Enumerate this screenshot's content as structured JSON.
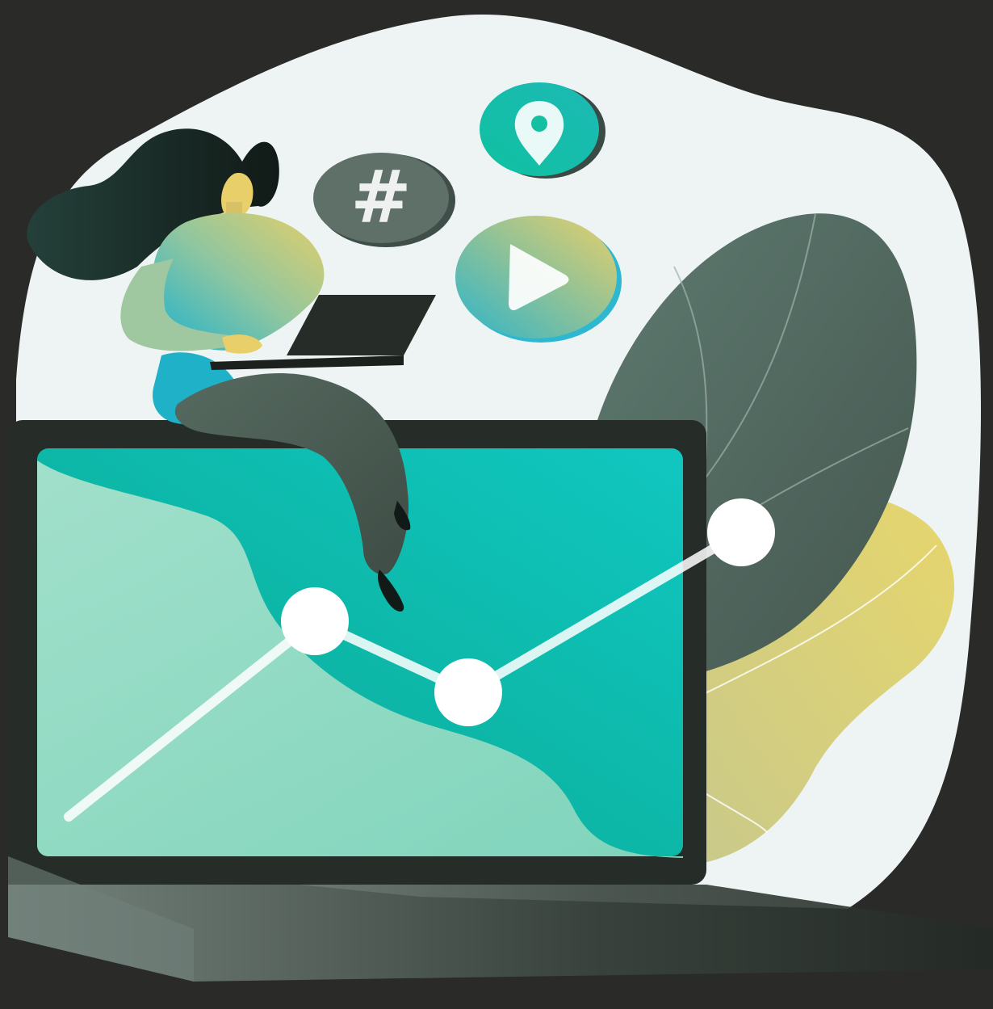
{
  "palette": {
    "background": "#2a2a29",
    "blob": "#eef4f3",
    "monitor_frame": "#262c27",
    "screen_teal": "#0bbfa6",
    "screen_mint": "#9adcc6",
    "leaf_dark": "#5a7068",
    "leaf_yellow": "#e4d270",
    "hair": "#1b2a26",
    "skin_yellow": "#e8cf6a",
    "shirt_teal": "#1fb1c8",
    "pants": "#4a5a52",
    "chart_line": "#ffffff"
  },
  "icons": {
    "hashtag": "hashtag-icon",
    "location": "location-pin-icon",
    "play": "play-icon"
  },
  "hashtag_symbol": "#",
  "chart_points": [
    {
      "label": "point-1",
      "value": 0.18
    },
    {
      "label": "point-2",
      "value": 0.62
    },
    {
      "label": "point-3",
      "value": 0.46
    },
    {
      "label": "point-4",
      "value": 0.82
    }
  ]
}
